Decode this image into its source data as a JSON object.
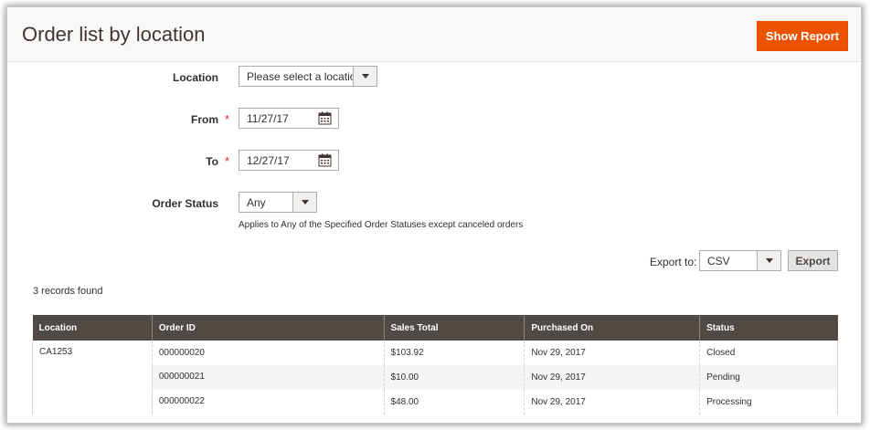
{
  "header": {
    "title": "Order list by location",
    "show_report_label": "Show Report"
  },
  "filters": {
    "location": {
      "label": "Location",
      "value": "Please select a location"
    },
    "from": {
      "label": "From",
      "value": "11/27/17",
      "required_mark": "*"
    },
    "to": {
      "label": "To",
      "value": "12/27/17",
      "required_mark": "*"
    },
    "order_status": {
      "label": "Order Status",
      "value": "Any",
      "note": "Applies to Any of the Specified Order Statuses except canceled orders"
    }
  },
  "export": {
    "label": "Export to:",
    "format": "CSV",
    "button_label": "Export"
  },
  "results": {
    "count_text": "3 records found",
    "columns": [
      "Location",
      "Order ID",
      "Sales Total",
      "Purchased On",
      "Status"
    ],
    "location_group": "CA1253",
    "rows": [
      {
        "order_id": "000000020",
        "sales_total": "$103.92",
        "purchased_on": "Nov 29, 2017",
        "status": "Closed"
      },
      {
        "order_id": "000000021",
        "sales_total": "$10.00",
        "purchased_on": "Nov 29, 2017",
        "status": "Pending"
      },
      {
        "order_id": "000000022",
        "sales_total": "$48.00",
        "purchased_on": "Nov 29, 2017",
        "status": "Processing"
      }
    ]
  },
  "icons": {
    "calendar": "calendar-icon",
    "dropdown": "chevron-down-icon"
  },
  "colors": {
    "accent": "#eb5202",
    "table_header": "#514943",
    "required": "#e22626"
  }
}
